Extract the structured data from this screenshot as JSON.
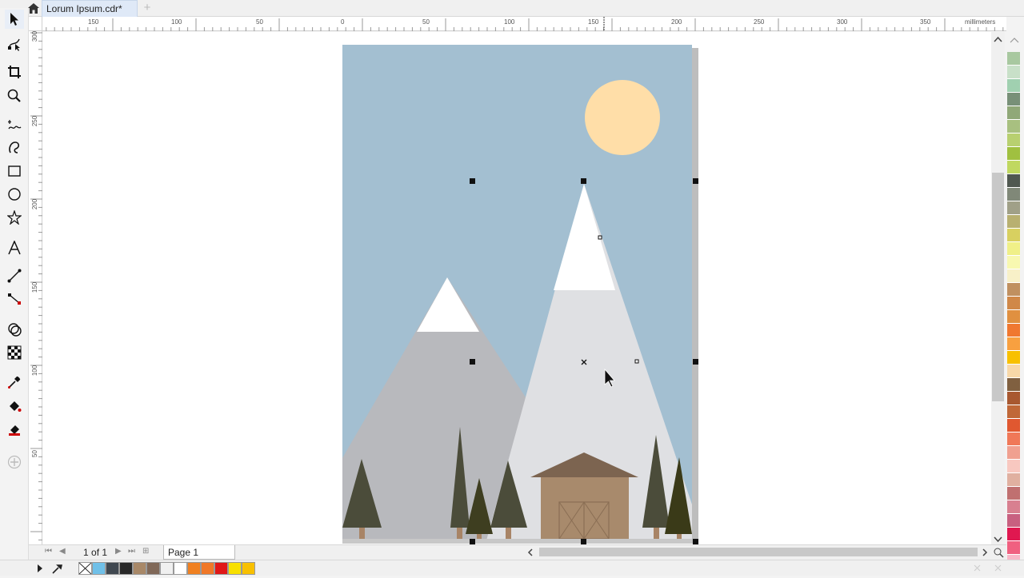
{
  "document": {
    "tab_title": "Lorum Ipsum.cdr*",
    "new_tab_label": "+"
  },
  "ruler": {
    "unit": "millimeters",
    "h_labels": [
      "150",
      "100",
      "50",
      "0",
      "50",
      "100",
      "150",
      "200",
      "250",
      "300",
      "350"
    ],
    "v_labels": [
      "300",
      "250",
      "200",
      "150",
      "100",
      "50"
    ]
  },
  "toolbox": {
    "tools": [
      "pick-tool",
      "shape-tool",
      "crop-tool",
      "zoom-tool",
      "freehand-tool",
      "artistic-media-tool",
      "rectangle-tool",
      "ellipse-tool",
      "polygon-tool",
      "text-tool",
      "parallel-dimension-tool",
      "connector-tool",
      "drop-shadow-tool",
      "transparency-tool",
      "eyedropper-tool",
      "interactive-fill-tool",
      "smart-fill-tool",
      "add-tool"
    ]
  },
  "pages": {
    "current": "1",
    "of_label": "of",
    "total": "1",
    "page_tab": "Page 1"
  },
  "palette": {
    "colors": [
      "#a8c8a0",
      "#c8e0c8",
      "#a0d0b0",
      "#789078",
      "#90a878",
      "#a8c080",
      "#b8d070",
      "#a0c040",
      "#c0d860",
      "#505850",
      "#808878",
      "#a0a088",
      "#b8b070",
      "#d8d060",
      "#f0f088",
      "#f8f8b0",
      "#f8f0c8",
      "#c09060",
      "#d08848",
      "#e09040",
      "#f07830",
      "#f8a040",
      "#f8c000",
      "#f8d8a8",
      "#806040",
      "#a85830",
      "#c06838",
      "#e05830",
      "#f07858",
      "#f0a090",
      "#f8c8c0",
      "#e0b0a0",
      "#c07070",
      "#d88090",
      "#c86080",
      "#e01850",
      "#f06080",
      "#f8b8c8"
    ]
  },
  "doc_palette": {
    "colors": [
      "none",
      "#70c0e8",
      "#404850",
      "#282828",
      "#a88868",
      "#806858",
      "#f0f0f0",
      "#ffffff",
      "#f08020",
      "#f07828",
      "#e01818",
      "#f8e000",
      "#f8c000"
    ]
  },
  "illustration": {
    "sky": "#a3bfd1",
    "sun": "#ffdea8",
    "mountain_left": "#b8b9bd",
    "mountain_right": "#dfe0e3",
    "snow": "#ffffff",
    "tree": "#4b4c3a",
    "trunk": "#a88466",
    "cabin": "#a88a6c",
    "roof": "#7c6450",
    "door_lines": "#8a6e54"
  }
}
